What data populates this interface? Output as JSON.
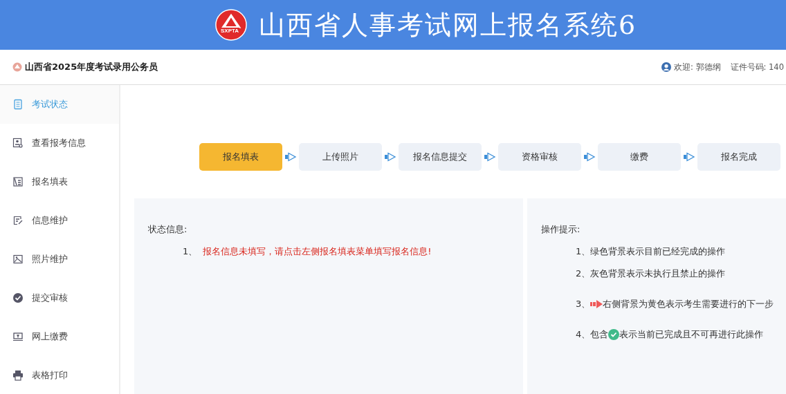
{
  "banner": {
    "logo_text": "SXPTA",
    "title": "山西省人事考试网上报名系统6"
  },
  "header": {
    "exam_name": "山西省2025年度考试录用公务员",
    "welcome": "欢迎: 郭德纲",
    "id_label": "证件号码: 140"
  },
  "sidebar": {
    "items": [
      {
        "label": "考试状态",
        "kind": "doc",
        "selected": true
      },
      {
        "label": "查看报考信息",
        "kind": "profile",
        "selected": false
      },
      {
        "label": "报名填表",
        "kind": "form",
        "selected": false
      },
      {
        "label": "信息维护",
        "kind": "edit",
        "selected": false
      },
      {
        "label": "照片维护",
        "kind": "image",
        "selected": false
      },
      {
        "label": "提交审核",
        "kind": "check",
        "selected": false
      },
      {
        "label": "网上缴费",
        "kind": "pay",
        "selected": false
      },
      {
        "label": "表格打印",
        "kind": "print",
        "selected": false
      }
    ]
  },
  "steps": [
    {
      "label": "报名填表",
      "selected": true
    },
    {
      "label": "上传照片",
      "selected": false
    },
    {
      "label": "报名信息提交",
      "selected": false
    },
    {
      "label": "资格审核",
      "selected": false
    },
    {
      "label": "缴费",
      "selected": false
    },
    {
      "label": "报名完成",
      "selected": false
    }
  ],
  "status": {
    "title": "状态信息:",
    "messages": [
      {
        "number": "1、",
        "text": "报名信息未填写，请点击左侧报名填表菜单填写报名信息!"
      }
    ]
  },
  "tips": {
    "title": "操作提示:",
    "items": [
      {
        "number": "1、",
        "kind": "plain",
        "text": "绿色背景表示目前已经完成的操作"
      },
      {
        "number": "2、",
        "kind": "plain",
        "text": "灰色背景表示未执行且禁止的操作"
      },
      {
        "number": "3、",
        "kind": "arrow",
        "text": "右侧背景为黄色表示考生需要进行的下一步"
      },
      {
        "number": "4、",
        "kind": "check",
        "text": "表示当前已完成且不可再进行此操作",
        "prefix": "包含"
      }
    ]
  }
}
